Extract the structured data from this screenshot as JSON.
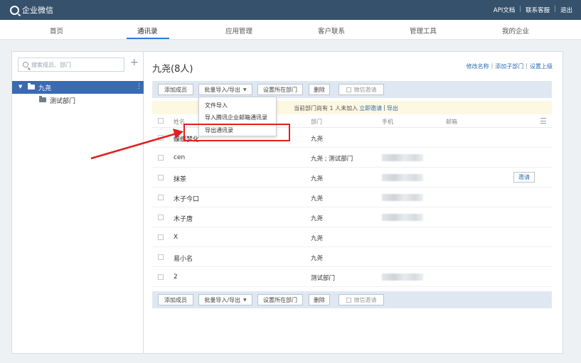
{
  "app": {
    "title": "企业微信"
  },
  "toplinks": [
    "API文档",
    "联系客服",
    "退出"
  ],
  "nav": {
    "items": [
      "首页",
      "通讯录",
      "应用管理",
      "客户联系",
      "管理工具",
      "我的企业"
    ]
  },
  "sidebar": {
    "search_placeholder": "搜索成员、部门",
    "tree": {
      "root": "九尧",
      "children": [
        "测试部门"
      ]
    }
  },
  "main": {
    "title": "九尧(8人)",
    "title_links": [
      "修改名称",
      "添加子部门",
      "设置上级"
    ],
    "toolbar": {
      "add_member": "添加成员",
      "batch": "批量导入/导出",
      "set_dept": "设置所在部门",
      "delete": "删除",
      "wechat_invite": "微信邀请"
    },
    "dropdown": [
      "文件导入",
      "导入腾讯企业邮箱通讯录",
      "导出通讯录"
    ],
    "notice": {
      "text": "当前部门尚有 1 人未加入",
      "invite_link": "立即邀请",
      "sep": "|",
      "export_link": "导出"
    },
    "columns": [
      "姓名",
      "部门",
      "手机",
      "邮箱"
    ],
    "rows": [
      {
        "name": "蝶蝶梦化",
        "dept": "九尧"
      },
      {
        "name": "cen",
        "dept": "九尧 ; 测试部门"
      },
      {
        "name": "抹茶",
        "dept": "九尧",
        "action": "邀请"
      },
      {
        "name": "木子今口",
        "dept": "九尧"
      },
      {
        "name": "木子唐",
        "dept": "九尧"
      },
      {
        "name": "X",
        "dept": "九尧"
      },
      {
        "name": "易小名",
        "dept": "九尧"
      },
      {
        "name": "2",
        "dept": "测试部门"
      }
    ]
  },
  "colors": {
    "topbar": "#35516c",
    "accent": "#2b7fd1",
    "tree_selected": "#3a6bb1",
    "highlight": "#e02020"
  }
}
